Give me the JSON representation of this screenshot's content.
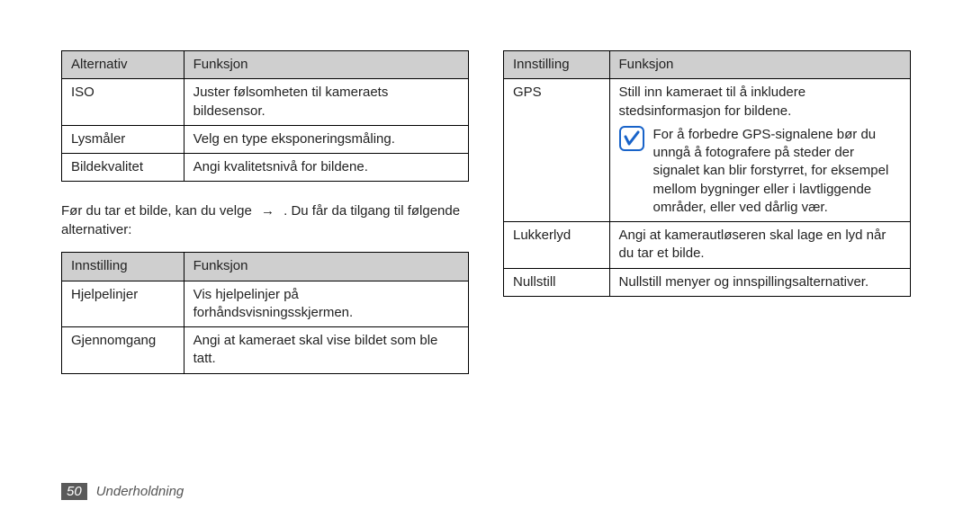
{
  "tables": {
    "t1": {
      "headers": [
        "Alternativ",
        "Funksjon"
      ],
      "rows": [
        [
          "ISO",
          "Juster følsomheten til kameraets bildesensor."
        ],
        [
          "Lysmåler",
          "Velg en type eksponeringsmåling."
        ],
        [
          "Bildekvalitet",
          "Angi kvalitetsnivå for bildene."
        ]
      ]
    },
    "t2": {
      "headers": [
        "Innstilling",
        "Funksjon"
      ],
      "rows": [
        [
          "Hjelpelinjer",
          "Vis hjelpelinjer på forhåndsvisningsskjermen."
        ],
        [
          "Gjennomgang",
          "Angi at kameraet skal vise bildet som ble tatt."
        ]
      ]
    },
    "t3": {
      "headers": [
        "Innstilling",
        "Funksjon"
      ],
      "rows": [
        {
          "c0": "GPS",
          "intro": "Still inn kameraet til å inkludere stedsinformasjon for bildene.",
          "note": "For å forbedre GPS-signalene bør du unngå å fotografere på steder der signalet kan blir forstyrret, for eksempel mellom bygninger eller i lavtliggende områder, eller ved dårlig vær."
        },
        [
          "Lukkerlyd",
          "Angi at kamerautløseren skal lage en lyd når du tar et bilde."
        ],
        [
          "Nullstill",
          "Nullstill menyer og innspillingsalternativer."
        ]
      ]
    }
  },
  "mid_paragraph": {
    "before": "Før du tar et bilde, kan du velge",
    "arrow": "→",
    "after": ".  Du får da tilgang til følgende alternativer:"
  },
  "footer": {
    "page": "50",
    "section": "Underholdning"
  },
  "icons": {
    "note": "note-icon"
  }
}
